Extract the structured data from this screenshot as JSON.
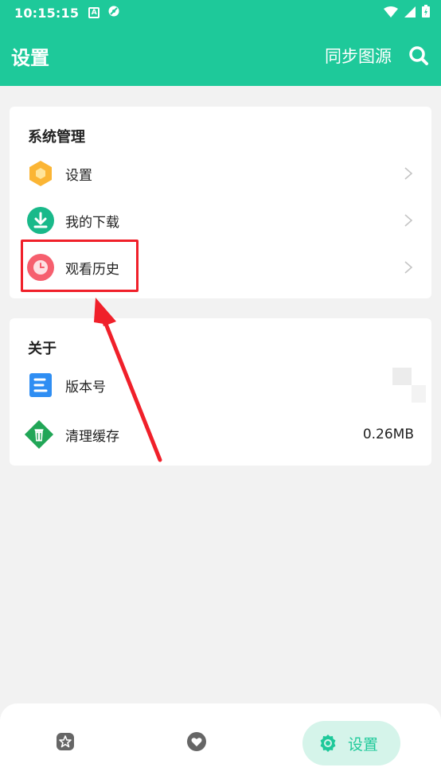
{
  "status_bar": {
    "time": "10:15:15",
    "a_badge": "A"
  },
  "header": {
    "title": "设置",
    "sync_label": "同步图源"
  },
  "system_section": {
    "title": "系统管理",
    "items": [
      {
        "label": "设置",
        "icon": "settings-hexagon-icon"
      },
      {
        "label": "我的下载",
        "icon": "download-icon"
      },
      {
        "label": "观看历史",
        "icon": "history-clock-icon"
      }
    ]
  },
  "about_section": {
    "title": "关于",
    "items": [
      {
        "label": "版本号",
        "value": "",
        "icon": "document-icon"
      },
      {
        "label": "清理缓存",
        "value": "0.26MB",
        "icon": "cache-clean-icon"
      }
    ]
  },
  "bottom_nav": {
    "items": [
      {
        "name": "home",
        "icon": "star-badge-icon"
      },
      {
        "name": "favorites",
        "icon": "heart-icon"
      },
      {
        "name": "settings",
        "label": "设置",
        "icon": "gear-icon",
        "active": true
      }
    ]
  },
  "colors": {
    "accent": "#1ec99a",
    "accent_light": "#d5f4ea",
    "highlight": "#f0202a",
    "background": "#f2f2f2"
  }
}
